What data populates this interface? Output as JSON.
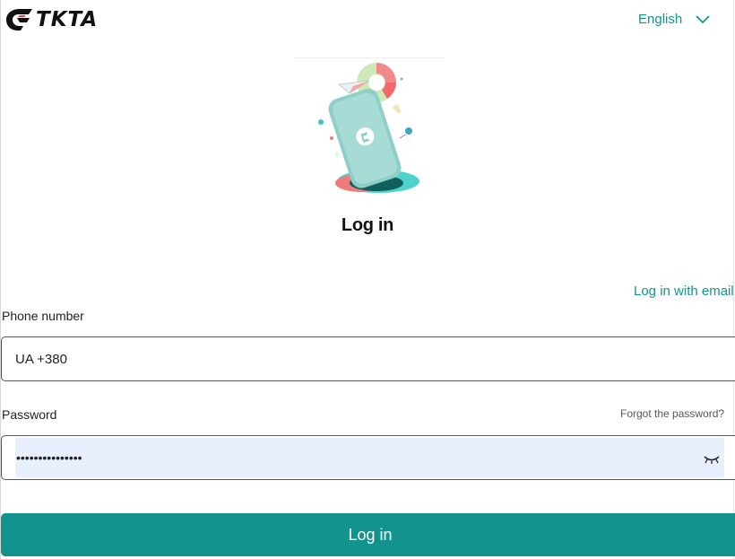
{
  "brand": {
    "name": "TKTA",
    "color": "#13938d"
  },
  "header": {
    "language_label": "English"
  },
  "main": {
    "title": "Log in",
    "alt_login_link": "Log in with email",
    "phone": {
      "label": "Phone number",
      "value": "UA +380"
    },
    "password": {
      "label": "Password",
      "value": "•••••••••••••••",
      "forgot_link": "Forgot the password?",
      "toggle_icon": "eye-closed-icon"
    },
    "submit_label": "Log in"
  }
}
